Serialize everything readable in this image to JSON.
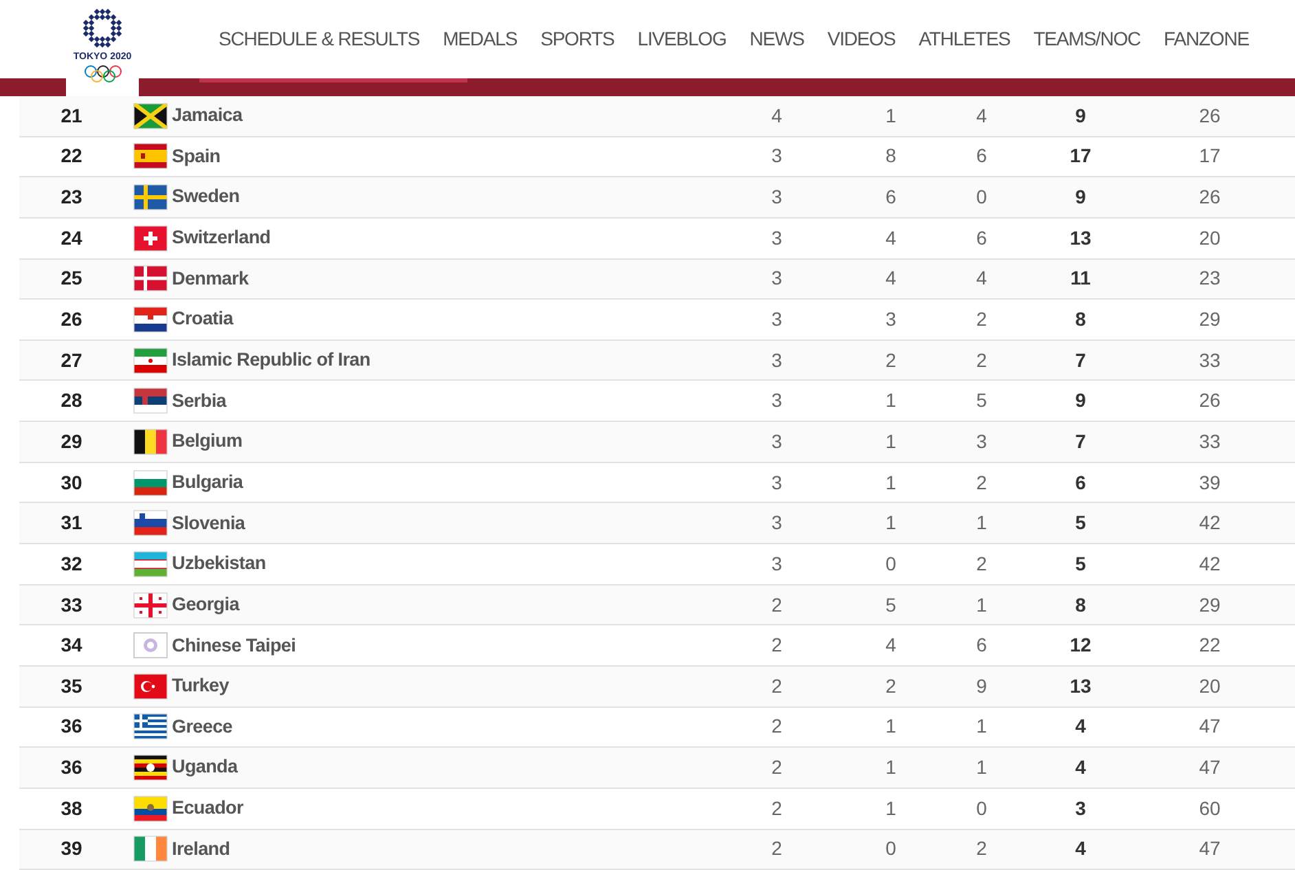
{
  "logo": {
    "caption": "TOKYO 2020"
  },
  "nav": [
    {
      "label": "SCHEDULE & RESULTS"
    },
    {
      "label": "MEDALS"
    },
    {
      "label": "SPORTS"
    },
    {
      "label": "LIVEBLOG"
    },
    {
      "label": "NEWS"
    },
    {
      "label": "VIDEOS"
    },
    {
      "label": "ATHLETES"
    },
    {
      "label": "TEAMS/NOC"
    },
    {
      "label": "FANZONE"
    }
  ],
  "rows": [
    {
      "rank": "21",
      "kind": "jm",
      "country": "Jamaica",
      "gold": "4",
      "silver": "1",
      "bronze": "4",
      "total": "9",
      "rank_by_total": "26"
    },
    {
      "rank": "22",
      "kind": "es",
      "country": "Spain",
      "gold": "3",
      "silver": "8",
      "bronze": "6",
      "total": "17",
      "rank_by_total": "17"
    },
    {
      "rank": "23",
      "kind": "se",
      "country": "Sweden",
      "gold": "3",
      "silver": "6",
      "bronze": "0",
      "total": "9",
      "rank_by_total": "26"
    },
    {
      "rank": "24",
      "kind": "ch",
      "country": "Switzerland",
      "gold": "3",
      "silver": "4",
      "bronze": "6",
      "total": "13",
      "rank_by_total": "20"
    },
    {
      "rank": "25",
      "kind": "dk",
      "country": "Denmark",
      "gold": "3",
      "silver": "4",
      "bronze": "4",
      "total": "11",
      "rank_by_total": "23"
    },
    {
      "rank": "26",
      "kind": "hr",
      "country": "Croatia",
      "gold": "3",
      "silver": "3",
      "bronze": "2",
      "total": "8",
      "rank_by_total": "29"
    },
    {
      "rank": "27",
      "kind": "ir",
      "country": "Islamic Republic of Iran",
      "gold": "3",
      "silver": "2",
      "bronze": "2",
      "total": "7",
      "rank_by_total": "33"
    },
    {
      "rank": "28",
      "kind": "rs",
      "country": "Serbia",
      "gold": "3",
      "silver": "1",
      "bronze": "5",
      "total": "9",
      "rank_by_total": "26"
    },
    {
      "rank": "29",
      "kind": "be",
      "country": "Belgium",
      "gold": "3",
      "silver": "1",
      "bronze": "3",
      "total": "7",
      "rank_by_total": "33"
    },
    {
      "rank": "30",
      "kind": "bg",
      "country": "Bulgaria",
      "gold": "3",
      "silver": "1",
      "bronze": "2",
      "total": "6",
      "rank_by_total": "39"
    },
    {
      "rank": "31",
      "kind": "si",
      "country": "Slovenia",
      "gold": "3",
      "silver": "1",
      "bronze": "1",
      "total": "5",
      "rank_by_total": "42"
    },
    {
      "rank": "32",
      "kind": "uz",
      "country": "Uzbekistan",
      "gold": "3",
      "silver": "0",
      "bronze": "2",
      "total": "5",
      "rank_by_total": "42"
    },
    {
      "rank": "33",
      "kind": "ge",
      "country": "Georgia",
      "gold": "2",
      "silver": "5",
      "bronze": "1",
      "total": "8",
      "rank_by_total": "29"
    },
    {
      "rank": "34",
      "kind": "tpe",
      "country": "Chinese Taipei",
      "gold": "2",
      "silver": "4",
      "bronze": "6",
      "total": "12",
      "rank_by_total": "22"
    },
    {
      "rank": "35",
      "kind": "tr",
      "country": "Turkey",
      "gold": "2",
      "silver": "2",
      "bronze": "9",
      "total": "13",
      "rank_by_total": "20"
    },
    {
      "rank": "36",
      "kind": "gr",
      "country": "Greece",
      "gold": "2",
      "silver": "1",
      "bronze": "1",
      "total": "4",
      "rank_by_total": "47"
    },
    {
      "rank": "36",
      "kind": "ug",
      "country": "Uganda",
      "gold": "2",
      "silver": "1",
      "bronze": "1",
      "total": "4",
      "rank_by_total": "47"
    },
    {
      "rank": "38",
      "kind": "ec",
      "country": "Ecuador",
      "gold": "2",
      "silver": "1",
      "bronze": "0",
      "total": "3",
      "rank_by_total": "60"
    },
    {
      "rank": "39",
      "kind": "ie",
      "country": "Ireland",
      "gold": "2",
      "silver": "0",
      "bronze": "2",
      "total": "4",
      "rank_by_total": "47"
    }
  ]
}
